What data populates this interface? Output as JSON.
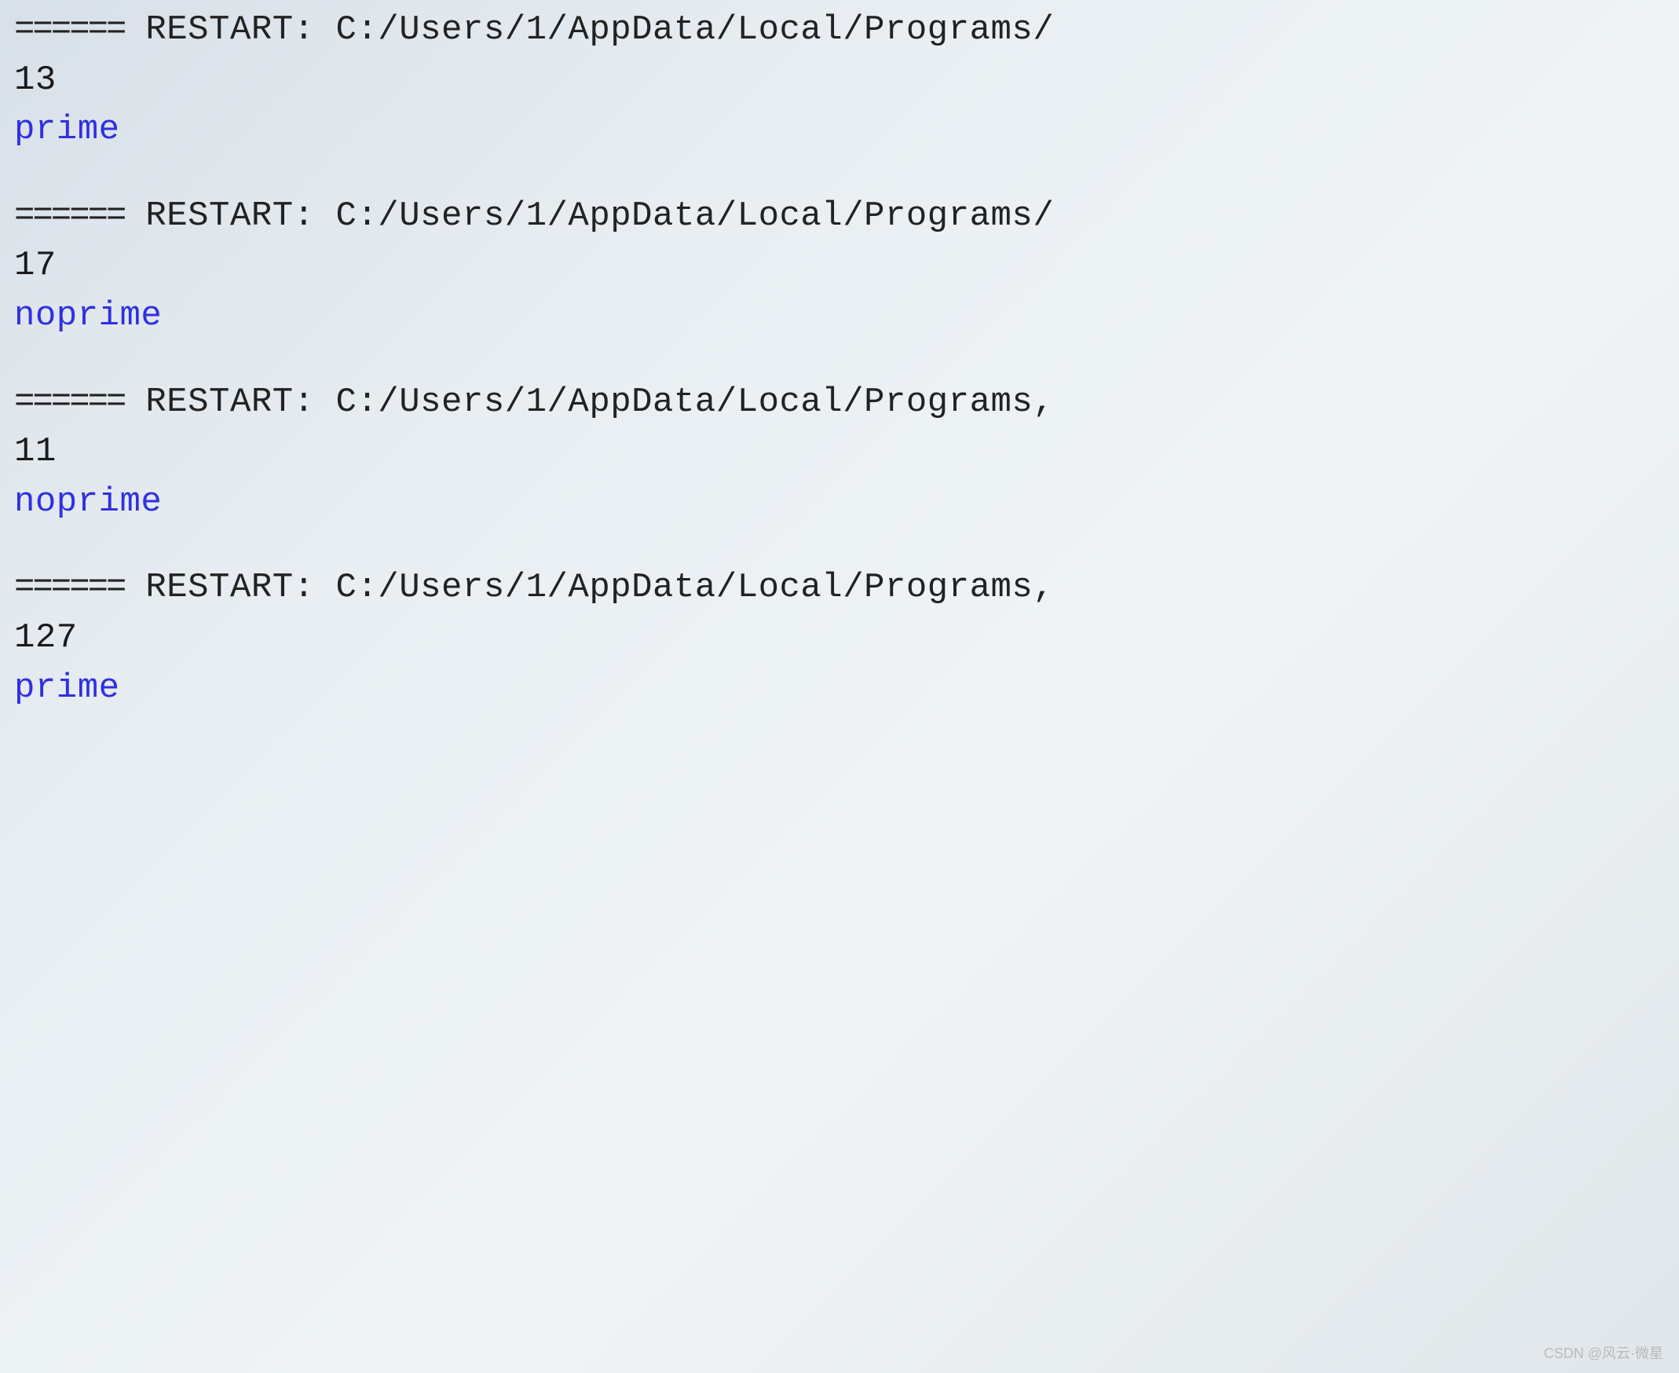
{
  "runs": [
    {
      "restart_prefix": "======",
      "restart_label": " RESTART: ",
      "restart_path": "C:/Users/1/AppData/Local/Programs/",
      "input": "13",
      "output": "prime"
    },
    {
      "restart_prefix": "======",
      "restart_label": " RESTART: ",
      "restart_path": "C:/Users/1/AppData/Local/Programs/",
      "input": "17",
      "output": "noprime"
    },
    {
      "restart_prefix": "======",
      "restart_label": " RESTART: ",
      "restart_path": "C:/Users/1/AppData/Local/Programs,",
      "input": "11",
      "output": "noprime"
    },
    {
      "restart_prefix": "======",
      "restart_label": " RESTART: ",
      "restart_path": "C:/Users/1/AppData/Local/Programs,",
      "input": "127",
      "output": "prime"
    }
  ],
  "watermark": "CSDN @风云·微星"
}
